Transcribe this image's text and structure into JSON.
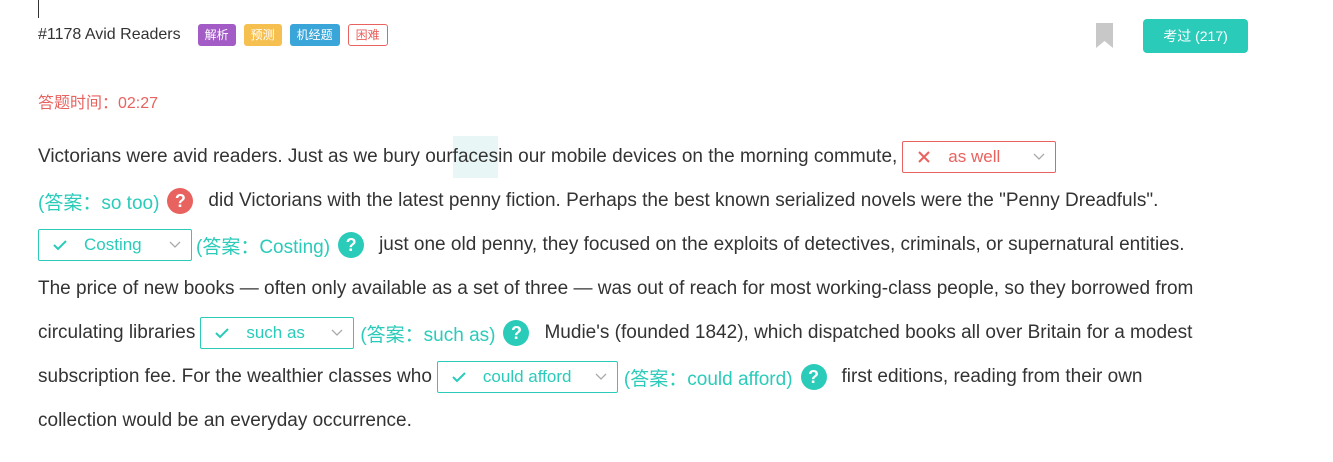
{
  "header": {
    "title": "#1178 Avid Readers",
    "tags": [
      "解析",
      "预测",
      "机经题",
      "困难"
    ],
    "bookmark_icon": "bookmark-icon",
    "passed_button": "考过 (217)"
  },
  "timer": "答题时间：02:27",
  "colors": {
    "accent": "#2bcbba",
    "error": "#e8625f"
  },
  "passage": {
    "line1_a": "Victorians were avid readers. Just as we bury our ",
    "line1_hl": "faces",
    "line1_b": " in our mobile devices on the morning commute,",
    "blank1": {
      "value": "as well",
      "status": "wrong",
      "answer": "(答案：so too)"
    },
    "line2": "did Victorians with the latest penny fiction. Perhaps the best known serialized novels were the \"Penny Dreadfuls\".",
    "blank2": {
      "value": "Costing",
      "status": "correct",
      "answer": "(答案：Costing)"
    },
    "line3": "just one old penny, they focused on the exploits of detectives, criminals, or supernatural entities.",
    "line4": "The price of new books — often only available as a set of three — was out of reach for most working-class people, so they borrowed from",
    "line5_a": "circulating libraries",
    "blank3": {
      "value": "such as",
      "status": "correct",
      "answer": "(答案：such as)"
    },
    "line5_b": "Mudie's (founded 1842), which dispatched books all over Britain for a modest",
    "line6_a": "subscription fee. For the wealthier classes who",
    "blank4": {
      "value": "could afford",
      "status": "correct",
      "answer": "(答案：could afford)"
    },
    "line6_b": "first editions, reading from their own",
    "line7": "collection would be an everyday occurrence."
  },
  "help_icon": "?"
}
